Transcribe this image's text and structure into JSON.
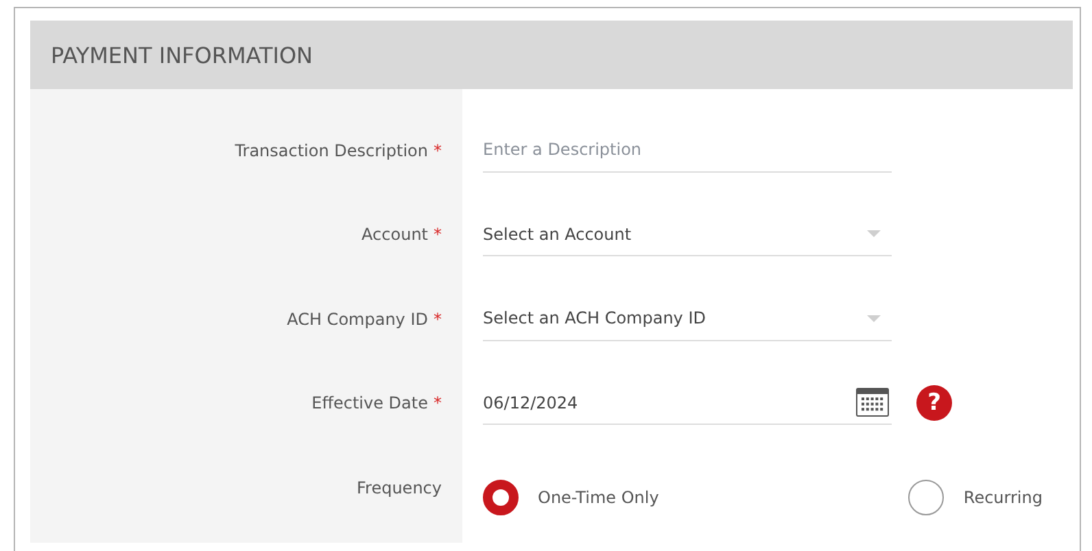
{
  "section": {
    "title": "PAYMENT INFORMATION"
  },
  "fields": [
    {
      "kind": "text",
      "label": "Transaction Description",
      "required_mark": "*",
      "placeholder": "Enter a Description"
    },
    {
      "kind": "select",
      "label": "Account",
      "required_mark": "*",
      "value": "Select an Account"
    },
    {
      "kind": "select",
      "label": "ACH Company ID",
      "required_mark": "*",
      "value": "Select an ACH Company ID"
    },
    {
      "kind": "date",
      "label": "Effective Date",
      "required_mark": "*",
      "value": "06/12/2024",
      "help": "?"
    },
    {
      "kind": "radio",
      "label": "Frequency",
      "options": [
        {
          "label": "One-Time Only",
          "selected": true
        },
        {
          "label": "Recurring",
          "selected": false
        }
      ]
    }
  ]
}
